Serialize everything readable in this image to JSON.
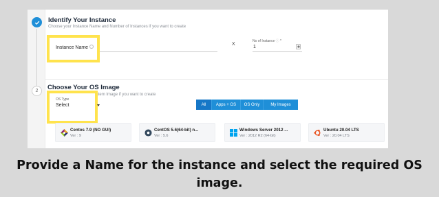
{
  "step1": {
    "title": "Identify Your Instance",
    "subtitle": "Choose your Instance Name and Number of Instances if you want to create",
    "instance_name_label": "Instance Name",
    "times_symbol": "X",
    "no_of_instance_label": "No of Instance",
    "no_of_instance_value": "1"
  },
  "step2": {
    "number": "2",
    "title": "Choose Your OS Image",
    "subtitle": "Choose your Operating System Image if you want to create",
    "os_type_label": "OS Type",
    "os_type_value": "Select",
    "filters": [
      "All",
      "Apps + OS",
      "OS Only",
      "My Images"
    ],
    "active_filter": "All"
  },
  "os_cards": [
    {
      "name": "Centos 7.9 (NO GUI)",
      "version": "Ver : 9",
      "icon": "centos-icon"
    },
    {
      "name": "CentOS 5.6(64-bit) n...",
      "version": "Ver : 5.6",
      "icon": "centos-icon"
    },
    {
      "name": "Windows Server 2012 ...",
      "version": "Ver : 2012 R2 (64-bit)",
      "icon": "windows-icon"
    },
    {
      "name": "Ubuntu 20.04 LTS",
      "version": "Ver : 20.04 LTS",
      "icon": "ubuntu-icon"
    }
  ],
  "caption": "Provide a Name for the instance and select the required OS image.",
  "colors": {
    "accent": "#1f8fd8",
    "highlight": "#ffe34d",
    "background": "#d9d9d9"
  }
}
